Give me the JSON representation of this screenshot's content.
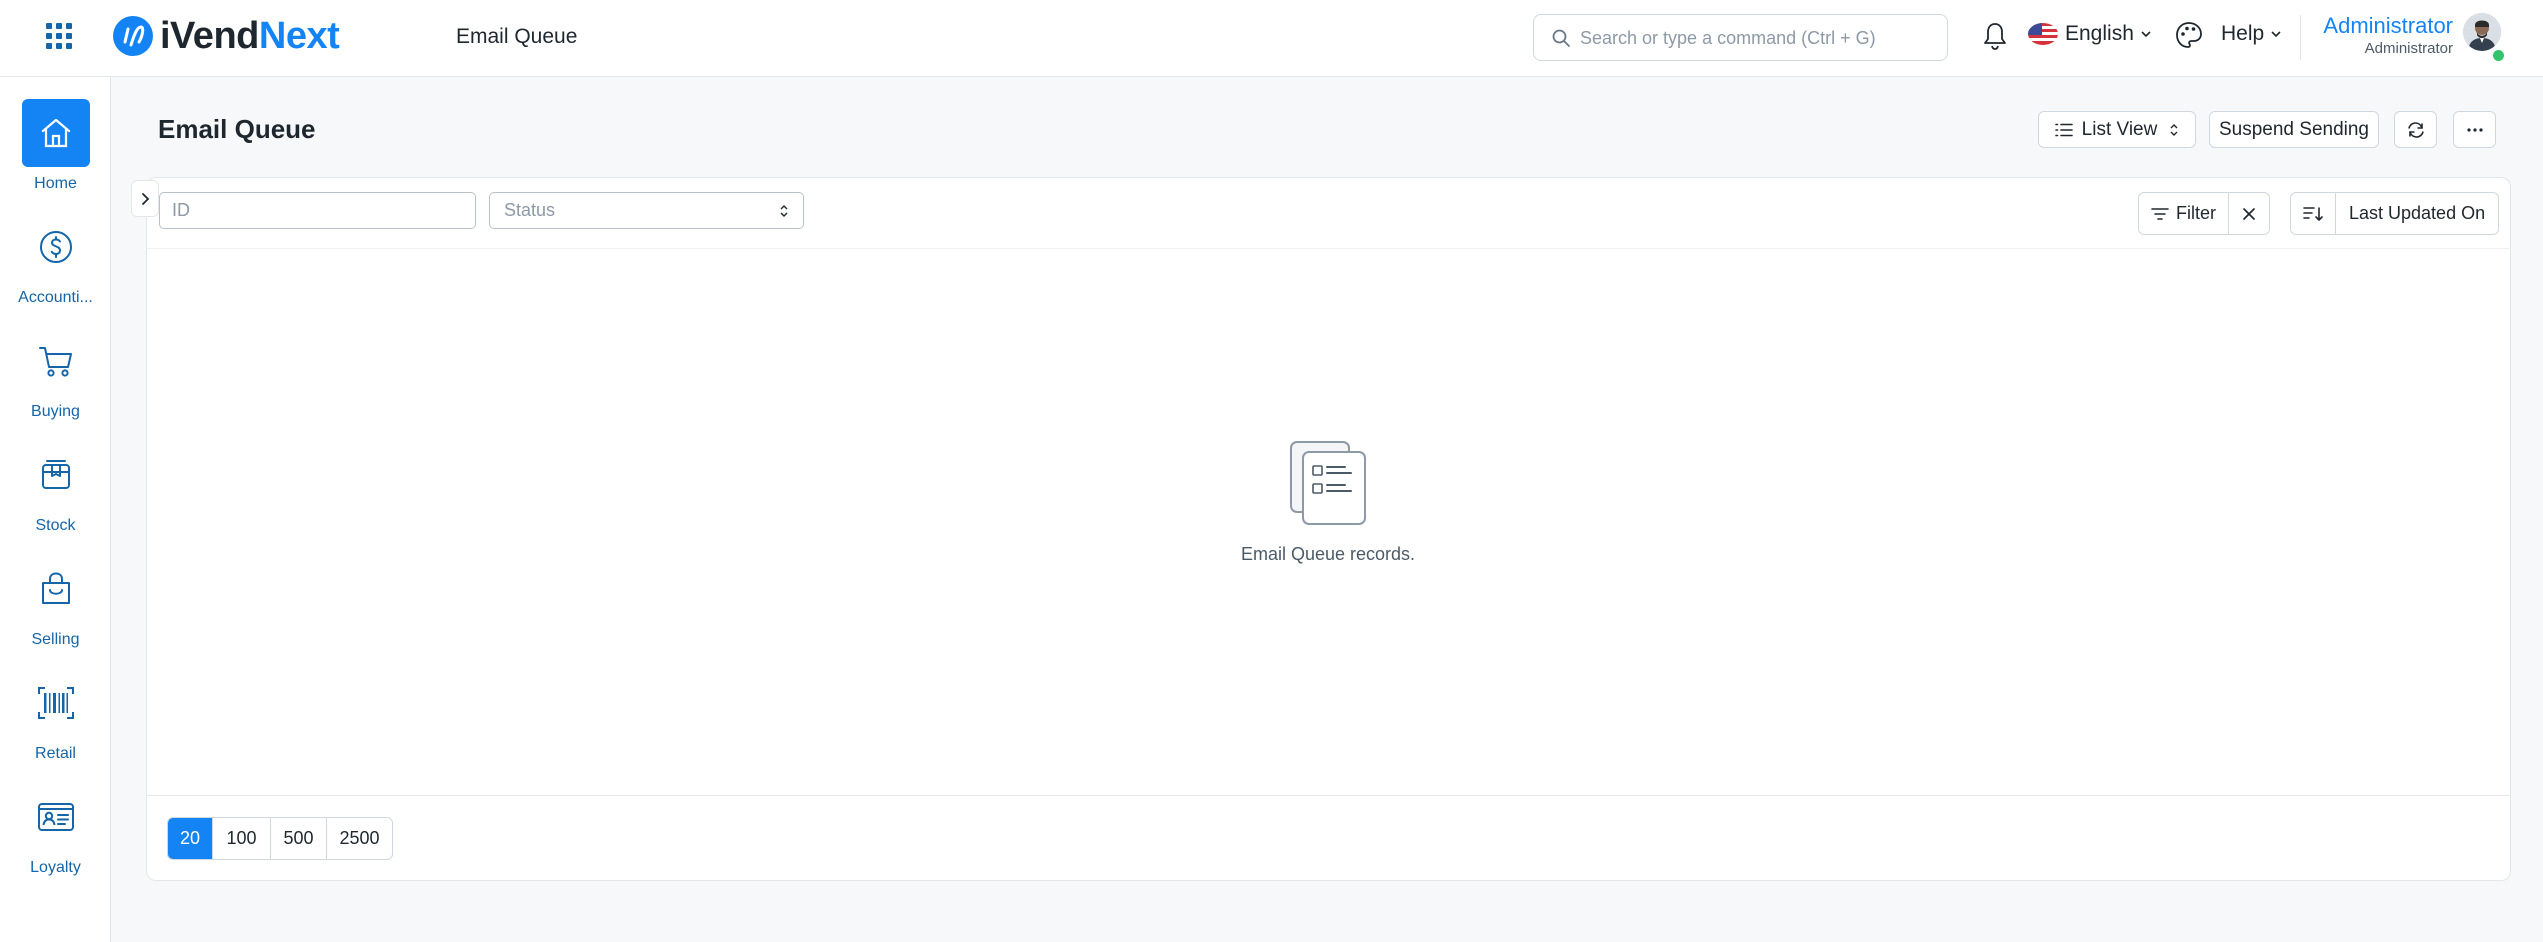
{
  "app": {
    "brand_part1": "iVend",
    "brand_part2": "Next",
    "breadcrumb": "Email Queue",
    "brand_color": "#1484f5"
  },
  "search": {
    "placeholder": "Search or type a command (Ctrl + G)"
  },
  "navbar": {
    "language": "English",
    "help": "Help",
    "user_name": "Administrator",
    "user_role": "Administrator",
    "icons": [
      "apps-grid-icon",
      "bell-icon",
      "us-flag-icon",
      "palette-icon",
      "avatar"
    ]
  },
  "sidebar": {
    "items": [
      {
        "label": "Home",
        "icon": "home-icon",
        "active": true
      },
      {
        "label": "Accounti...",
        "icon": "dollar-icon",
        "active": false
      },
      {
        "label": "Buying",
        "icon": "cart-icon",
        "active": false
      },
      {
        "label": "Stock",
        "icon": "box-icon",
        "active": false
      },
      {
        "label": "Selling",
        "icon": "shopping-bag-icon",
        "active": false
      },
      {
        "label": "Retail",
        "icon": "barcode-icon",
        "active": false
      },
      {
        "label": "Loyalty",
        "icon": "id-card-icon",
        "active": false
      }
    ]
  },
  "page": {
    "title": "Email Queue",
    "list_view_label": "List View",
    "suspend_label": "Suspend Sending",
    "refresh_icon": "refresh-icon",
    "more_icon": "ellipsis-icon"
  },
  "filters": {
    "id_placeholder": "ID",
    "status_placeholder": "Status",
    "filter_label": "Filter",
    "sort_label": "Last Updated On"
  },
  "empty_state": {
    "text": "Email Queue records."
  },
  "pagination": {
    "options": [
      "20",
      "100",
      "500",
      "2500"
    ],
    "selected": "20"
  }
}
